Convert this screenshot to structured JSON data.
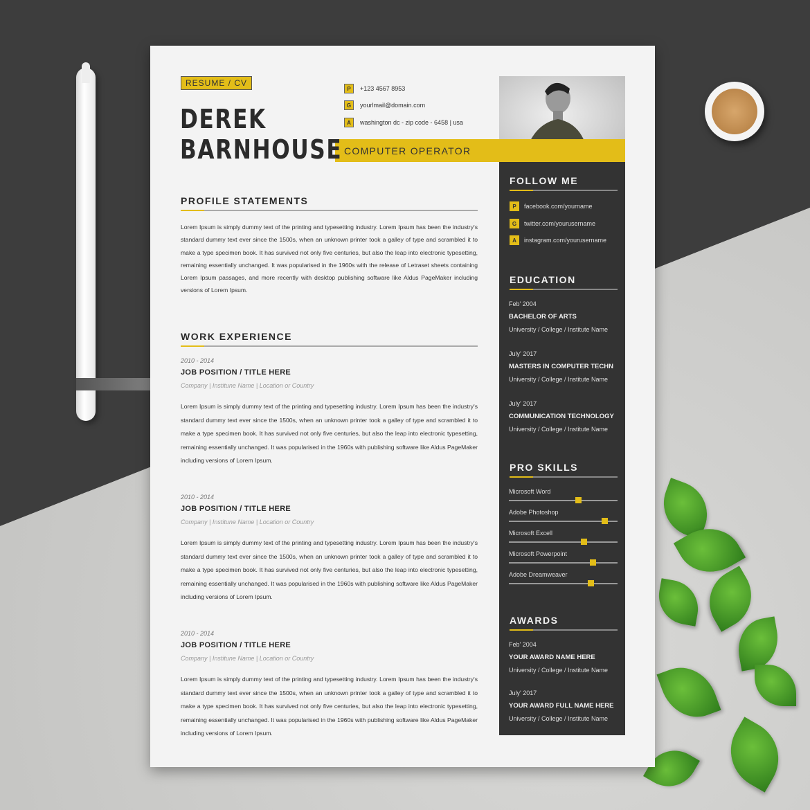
{
  "resume": {
    "tag": "RESUME / CV",
    "first_name": "DEREK",
    "last_name": "BARNHOUSE",
    "job_title": "COMPUTER OPERATOR",
    "contacts": [
      {
        "icon": "P",
        "text": "+123 4567 8953"
      },
      {
        "icon": "G",
        "text": "yourlmail@domain.com"
      },
      {
        "icon": "A",
        "text": "washington dc - zip code - 6458 | usa"
      }
    ],
    "profile": {
      "heading": "PROFILE STATEMENTS",
      "text": "Lorem Ipsum is simply dummy text of the printing and typesetting industry. Lorem Ipsum has been the industry's standard dummy text ever since the 1500s, when an unknown printer took a galley of type and scrambled it to make a type specimen book. It has survived not only five centuries, but also the leap into electronic typesetting, remaining essentially unchanged. It was popularised in the 1960s with the release of Letraset sheets containing Lorem Ipsum passages, and more recently with desktop publishing software like Aldus PageMaker including versions of Lorem Ipsum."
    },
    "work": {
      "heading": "WORK EXPERIENCE",
      "items": [
        {
          "date": "2010 - 2014",
          "title": "JOB POSITION / TITLE HERE",
          "company": "Company | Institune Name | Location or Country",
          "text": "Lorem Ipsum is simply dummy text of the printing and typesetting industry. Lorem Ipsum has been the industry's standard dummy text ever since the 1500s, when an unknown printer took a galley of type and scrambled it to make a type specimen book. It has survived not only five centuries, but also the leap into electronic typesetting, remaining essentially unchanged. It was popularised in the 1960s with publishing software like Aldus PageMaker including versions of Lorem Ipsum."
        },
        {
          "date": "2010 - 2014",
          "title": "JOB POSITION / TITLE HERE",
          "company": "Company | Institune Name | Location or Country",
          "text": "Lorem Ipsum is simply dummy text of the printing and typesetting industry. Lorem Ipsum has been the industry's standard dummy text ever since the 1500s, when an unknown printer took a galley of type and scrambled it to make a type specimen book. It has survived not only five centuries, but also the leap into electronic typesetting, remaining essentially unchanged. It was popularised in the 1960s with publishing software like Aldus PageMaker including versions of Lorem Ipsum."
        },
        {
          "date": "2010 - 2014",
          "title": "JOB POSITION / TITLE HERE",
          "company": "Company | Institune Name | Location or Country",
          "text": "Lorem Ipsum is simply dummy text of the printing and typesetting industry. Lorem Ipsum has been the industry's standard dummy text ever since the 1500s, when an unknown printer took a galley of type and scrambled it to make a type specimen book. It has survived not only five centuries, but also the leap into electronic typesetting, remaining essentially unchanged. It was popularised in the 1960s with publishing software like Aldus PageMaker including versions of Lorem Ipsum."
        }
      ]
    },
    "follow": {
      "heading": "FOLLOW ME",
      "items": [
        {
          "icon": "P",
          "text": "facebook.com/yourname"
        },
        {
          "icon": "G",
          "text": "twitter.com/yourusername"
        },
        {
          "icon": "A",
          "text": "instagram.com/yourusername"
        }
      ]
    },
    "education": {
      "heading": "EDUCATION",
      "items": [
        {
          "date": "Feb' 2004",
          "degree": "BACHELOR OF ARTS",
          "school": "University / College / Institute Name"
        },
        {
          "date": "July' 2017",
          "degree": "MASTERS IN COMPUTER TECHN",
          "school": "University / College / Institute Name"
        },
        {
          "date": "July' 2017",
          "degree": "COMMUNICATION TECHNOLOGY",
          "school": "University / College / Institute Name"
        }
      ]
    },
    "skills": {
      "heading": "PRO SKILLS",
      "items": [
        {
          "name": "Microsoft Word",
          "level": 0.64
        },
        {
          "name": "Adobe Photoshop",
          "level": 0.88
        },
        {
          "name": "Microsoft Excell",
          "level": 0.69
        },
        {
          "name": "Microsoft Powerpoint",
          "level": 0.77
        },
        {
          "name": "Adobe Dreamweaver",
          "level": 0.75
        }
      ]
    },
    "awards": {
      "heading": "AWARDS",
      "items": [
        {
          "date": "Feb' 2004",
          "name": "YOUR AWARD NAME HERE",
          "school": "University / College / Institute Name"
        },
        {
          "date": "July' 2017",
          "name": "YOUR AWARD FULL NAME HERE",
          "school": "University / College / Institute Name"
        }
      ]
    },
    "colors": {
      "accent": "#e3bd18",
      "sidebar": "#333333",
      "paper": "#f3f3f3"
    }
  }
}
